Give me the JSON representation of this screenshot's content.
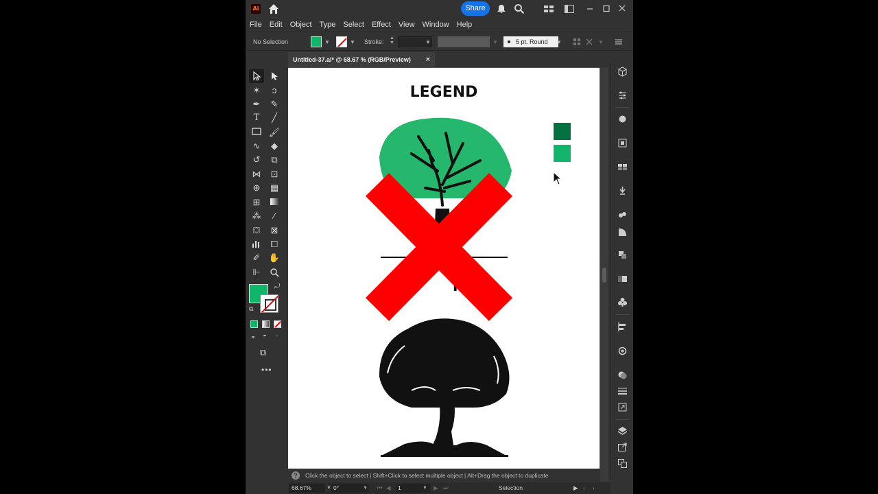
{
  "app": {
    "logo": "Ai",
    "share_label": "Share",
    "icons": [
      "home-icon",
      "notification-bell-icon",
      "search-icon",
      "arrange-documents-icon",
      "workspace-switcher-icon",
      "minimize-icon",
      "maximize-icon",
      "close-icon"
    ]
  },
  "menu": [
    "File",
    "Edit",
    "Object",
    "Type",
    "Select",
    "Effect",
    "View",
    "Window",
    "Help"
  ],
  "control_bar": {
    "selection_label": "No Selection",
    "stroke_label": "Stroke:",
    "brush_label": "5 pt. Round",
    "fill_color": "#11b56a",
    "stroke_color": "none"
  },
  "document": {
    "tab_title": "Untitled-37.ai* @ 68.67 % (RGB/Preview)",
    "close_glyph": "×"
  },
  "artwork": {
    "heading": "LEGEND",
    "partial_text": "PRO",
    "swatch_dark": "#037240",
    "swatch_light": "#11b56a",
    "leaf_green": "#25b86c",
    "x_mark_color": "#ff0000"
  },
  "status": {
    "hint_icon": "?",
    "hint": "Click the object to select  |  Shift+Click to select multiple object  |  Alt+Drag the object to duplicate",
    "zoom": "68.67%",
    "rotation": "0°",
    "artboard_number": "1",
    "current_tool": "Selection"
  }
}
